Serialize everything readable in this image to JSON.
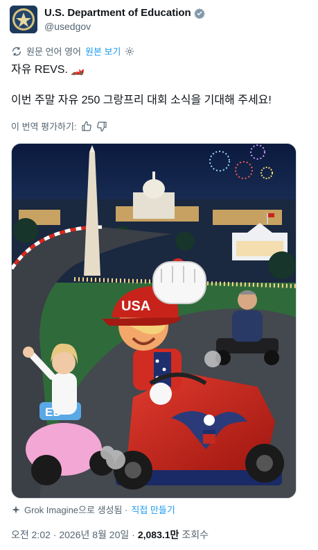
{
  "account": {
    "display_name": "U.S. Department of Education",
    "handle": "@usedgov"
  },
  "translation": {
    "label": "원문 언어 영어",
    "show_original": "원본 보기"
  },
  "tweet": {
    "line1": "자유 REVS. 🏎️",
    "line2": "이번 주말 자유 250 그랑프리 대회 소식을 기대해 주세요!"
  },
  "rate": {
    "label": "이 번역 평가하기:"
  },
  "image_text": {
    "cap_text": "USA",
    "kart_text": "ED"
  },
  "grok": {
    "generated": "Grok Imagine으로 생성됨 ·",
    "create_link": "직접 만들기"
  },
  "meta": {
    "time_date": "오전 2:02 · 2026년 8월 20일 ·",
    "views": "2,083.1만",
    "views_label": "조회수"
  },
  "colors": {
    "link": "#1d9bf0",
    "verified": "#829aab",
    "secondary_text": "#536471"
  }
}
